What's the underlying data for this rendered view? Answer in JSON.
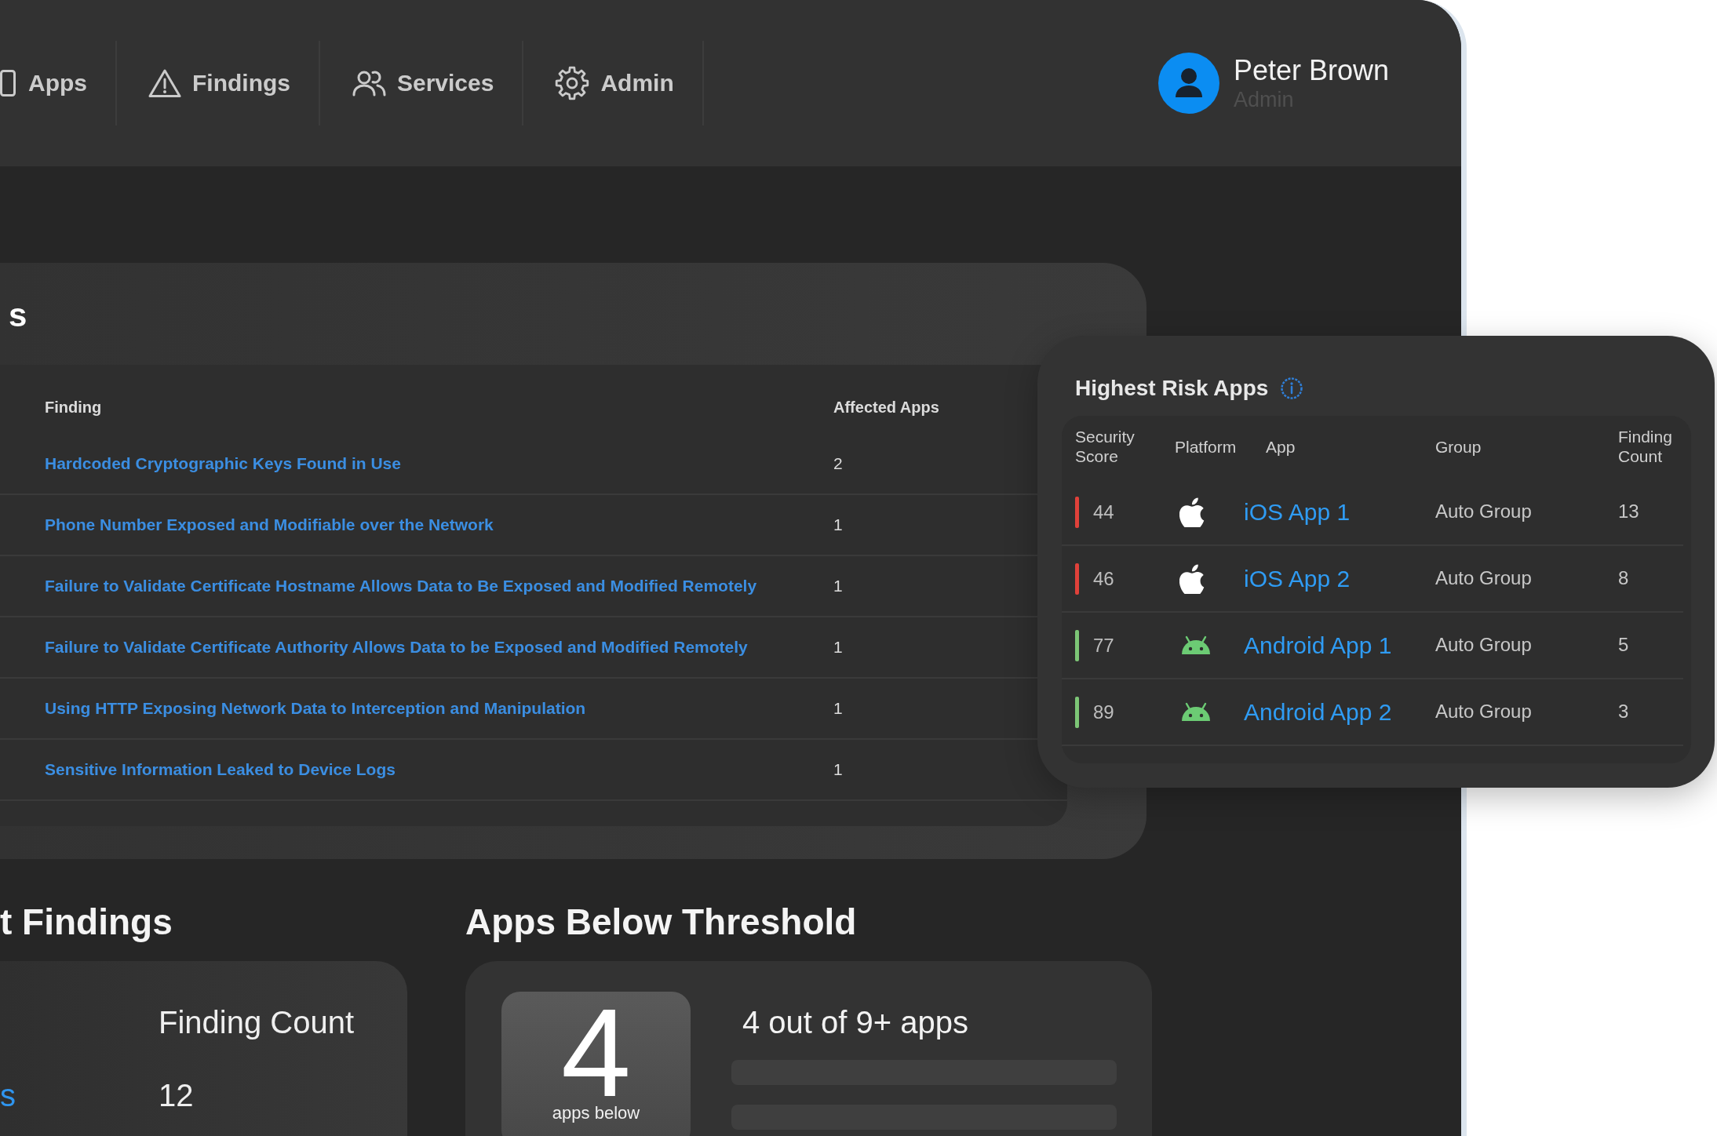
{
  "nav": {
    "items": [
      {
        "label": "Apps",
        "selected": false
      },
      {
        "label": "Findings",
        "selected": false
      },
      {
        "label": "Services",
        "selected": false
      },
      {
        "label": "Admin",
        "selected": false
      }
    ]
  },
  "user": {
    "name": "Peter Brown",
    "role": "Admin"
  },
  "findings_panel": {
    "title": "s",
    "columns": [
      "Finding",
      "Affected Apps"
    ],
    "rows": [
      {
        "finding": "Hardcoded Cryptographic Keys Found in Use",
        "affected_apps": "2"
      },
      {
        "finding": "Phone Number Exposed and Modifiable over the Network",
        "affected_apps": "1"
      },
      {
        "finding": "Failure to Validate Certificate Hostname Allows Data to Be Exposed and Modified Remotely",
        "affected_apps": "1"
      },
      {
        "finding": "Failure to Validate Certificate Authority Allows Data to be Exposed and Modified Remotely",
        "affected_apps": "1"
      },
      {
        "finding": "Using HTTP Exposing Network Data to Interception and Manipulation",
        "affected_apps": "1"
      },
      {
        "finding": "Sensitive Information Leaked to Device Logs",
        "affected_apps": "1"
      }
    ]
  },
  "highest_risk_apps": {
    "title": "Highest Risk Apps",
    "columns": [
      "Security Score",
      "Platform",
      "App",
      "Group",
      "Finding Count"
    ],
    "rows": [
      {
        "score": "44",
        "color": "#e0413a",
        "kind": "ios",
        "app": "iOS App 1",
        "group": "Auto Group",
        "finding_count": "13"
      },
      {
        "score": "46",
        "color": "#e0413a",
        "kind": "ios",
        "app": "iOS App 2",
        "group": "Auto Group",
        "finding_count": "8"
      },
      {
        "score": "77",
        "color": "#7cc576",
        "kind": "android",
        "app": "Android App 1",
        "group": "Auto Group",
        "finding_count": "5"
      },
      {
        "score": "89",
        "color": "#7cc576",
        "kind": "android",
        "app": "Android App 2",
        "group": "Auto Group",
        "finding_count": "3"
      }
    ]
  },
  "findings_count_panel": {
    "title": "t Findings",
    "column_2": "Finding Count",
    "rows": [
      {
        "column_1": "s",
        "column_2": "12"
      }
    ]
  },
  "apps_below_threshold": {
    "title": "Apps Below Threshold",
    "count": "4",
    "count_label": "apps below",
    "summary": "4 out of 9+ apps"
  }
}
